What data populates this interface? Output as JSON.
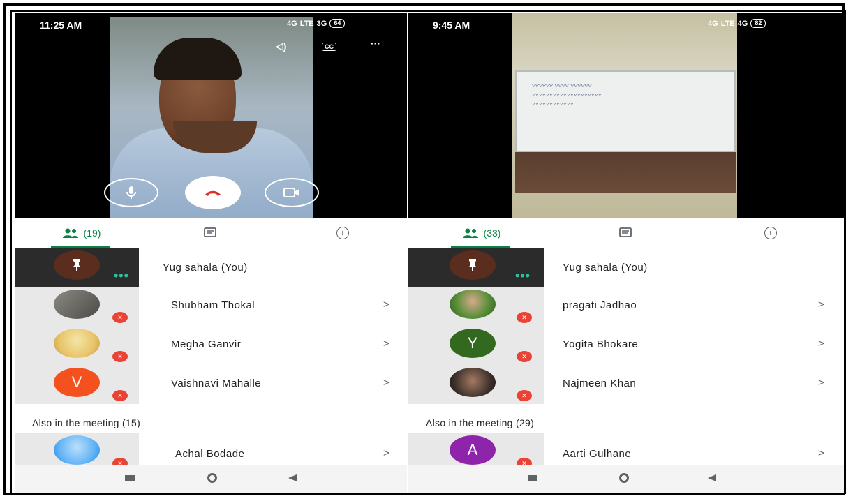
{
  "left": {
    "status_time": "11:25 AM",
    "status_network": "4G",
    "status_network2": "3G",
    "status_lte": "LTE",
    "battery": "64",
    "participants_count": "(19)",
    "self_name": "Yug sahala (You)",
    "participants": [
      {
        "name": "Shubham Thokal",
        "avatar": "photo",
        "color": "#6d6a66"
      },
      {
        "name": "Megha Ganvir",
        "avatar": "photo",
        "color": "#e9c46a"
      },
      {
        "name": "Vaishnavi Mahalle",
        "avatar": "V",
        "color": "#f4511e"
      }
    ],
    "also_label": "Also in the meeting (15)",
    "also": [
      {
        "name": "Achal Bodade",
        "avatar": "photo",
        "color": "#64b5f6"
      }
    ]
  },
  "right": {
    "status_time": "9:45 AM",
    "status_network": "4G",
    "status_network2": "4G",
    "status_lte": "LTE",
    "battery": "82",
    "participants_count": "(33)",
    "self_name": "Yug sahala (You)",
    "participants": [
      {
        "name": "pragati Jadhao",
        "avatar": "photo",
        "color": "#5a8f3a"
      },
      {
        "name": "Yogita Bhokare",
        "avatar": "Y",
        "color": "#33691e"
      },
      {
        "name": "Najmeen Khan",
        "avatar": "photo",
        "color": "#3b2f2a"
      }
    ],
    "also_label": "Also in the meeting (29)",
    "also": [
      {
        "name": "Aarti Gulhane",
        "avatar": "A",
        "color": "#8e24aa"
      }
    ]
  },
  "icons": {
    "people": "people-icon",
    "chat": "chat-icon",
    "info": "info-icon",
    "mute": "mic-off-icon",
    "chevron": "chevron-right-icon"
  },
  "glyphs": {
    "chevron": ">",
    "info": "i",
    "dots": "•••",
    "menu_dots": "···",
    "cc": "CC",
    "speaker": "◁)",
    "mic_off": "✕"
  },
  "colors": {
    "accent": "#0b8043",
    "mute": "#ea4335",
    "dots": "#2fbf9a"
  }
}
